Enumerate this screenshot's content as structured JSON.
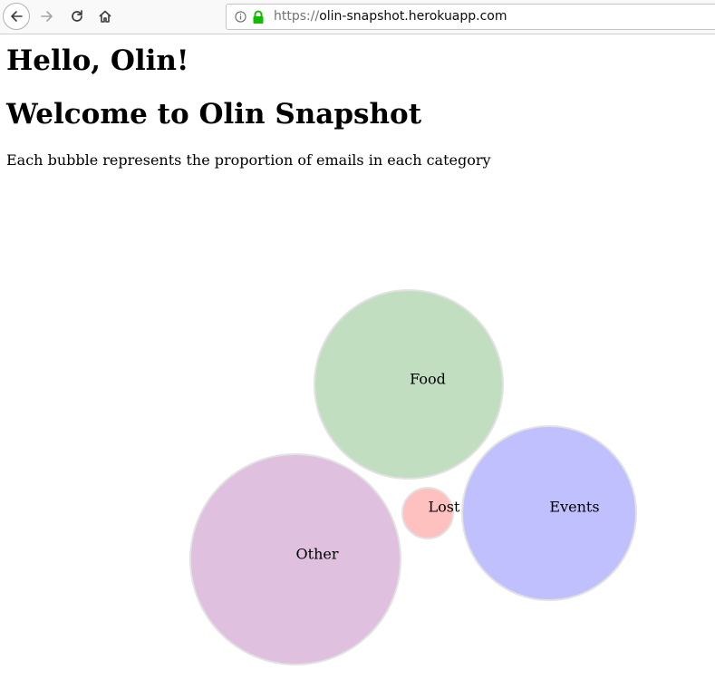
{
  "browser": {
    "url_scheme": "https://",
    "url_host": "olin-snapshot.herokuapp.com"
  },
  "page": {
    "greeting": "Hello, Olin!",
    "heading": "Welcome to Olin Snapshot",
    "description": "Each bubble represents the proportion of emails in each category"
  },
  "chart_data": {
    "type": "bubble",
    "series": [
      {
        "name": "Food",
        "color": "#c1dfc0"
      },
      {
        "name": "Events",
        "color": "#c1c0ff"
      },
      {
        "name": "Lost",
        "color": "#ffc0c0"
      },
      {
        "name": "Other",
        "color": "#dfc0df"
      }
    ]
  }
}
